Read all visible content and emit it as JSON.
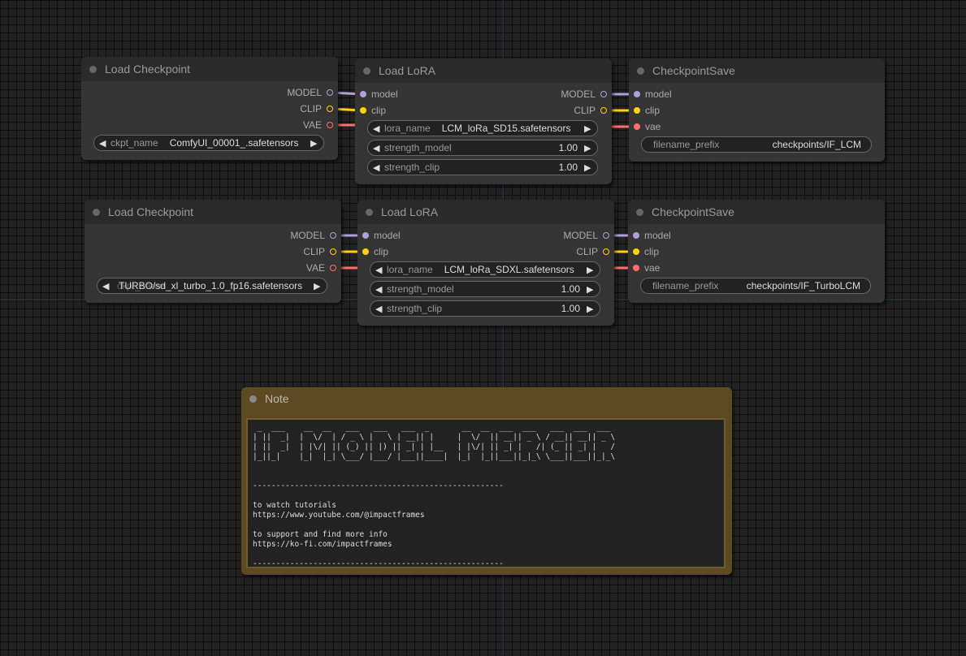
{
  "colors": {
    "background": "#222222",
    "node_body": "#353535",
    "node_title": "#2a2a2a",
    "note": "#5c4a23",
    "model_wire": "#b39ddb",
    "clip_wire": "#ffd500",
    "vae_wire": "#ff6e6e"
  },
  "row1": {
    "checkpoint": {
      "title": "Load Checkpoint",
      "outputs": {
        "model": "MODEL",
        "clip": "CLIP",
        "vae": "VAE"
      },
      "ckpt_label": "ckpt_name",
      "ckpt_value": "ComfyUI_00001_.safetensors"
    },
    "lora": {
      "title": "Load LoRA",
      "inputs": {
        "model": "model",
        "clip": "clip"
      },
      "outputs": {
        "model": "MODEL",
        "clip": "CLIP"
      },
      "lora_name_label": "lora_name",
      "lora_name_value": "LCM_loRa_SD15.safetensors",
      "strength_model_label": "strength_model",
      "strength_model_value": "1.00",
      "strength_clip_label": "strength_clip",
      "strength_clip_value": "1.00"
    },
    "save": {
      "title": "CheckpointSave",
      "inputs": {
        "model": "model",
        "clip": "clip",
        "vae": "vae"
      },
      "prefix_label": "filename_prefix",
      "prefix_value": "checkpoints/IF_LCM"
    }
  },
  "row2": {
    "checkpoint": {
      "title": "Load Checkpoint",
      "outputs": {
        "model": "MODEL",
        "clip": "CLIP",
        "vae": "VAE"
      },
      "ckpt_label": "ckpt_name",
      "ckpt_value": "TURBO/sd_xl_turbo_1.0_fp16.safetensors"
    },
    "lora": {
      "title": "Load LoRA",
      "inputs": {
        "model": "model",
        "clip": "clip"
      },
      "outputs": {
        "model": "MODEL",
        "clip": "CLIP"
      },
      "lora_name_label": "lora_name",
      "lora_name_value": "LCM_loRa_SDXL.safetensors",
      "strength_model_label": "strength_model",
      "strength_model_value": "1.00",
      "strength_clip_label": "strength_clip",
      "strength_clip_value": "1.00"
    },
    "save": {
      "title": "CheckpointSave",
      "inputs": {
        "model": "model",
        "clip": "clip",
        "vae": "vae"
      },
      "prefix_label": "filename_prefix",
      "prefix_value": "checkpoints/IF_TurboLCM"
    }
  },
  "note": {
    "title": "Note",
    "text": " _  ___    __  __   ___   ___   ___  _       __  __  ___  ___   ___  ___  ___\n| ||  _|  |  \\/  | / _ \\ |   \\ | __|| |     |  \\/  || __|| _ \\ / __|| __|| _ \\\n| ||  _|  | |\\/| || (_) || |) || _| | |__   | |\\/| || _| |   /| (_ || _| |   /\n|_||_|    |_|  |_| \\___/ |___/ |___||____|  |_|  |_||___||_|_\\ \\___||___||_|_\\\n\n\n------------------------------------------------------\n\nto watch tutorials\nhttps://www.youtube.com/@impactframes\n\nto support and find more info\nhttps://ko-fi.com/impactframes\n\n------------------------------------------------------"
  }
}
